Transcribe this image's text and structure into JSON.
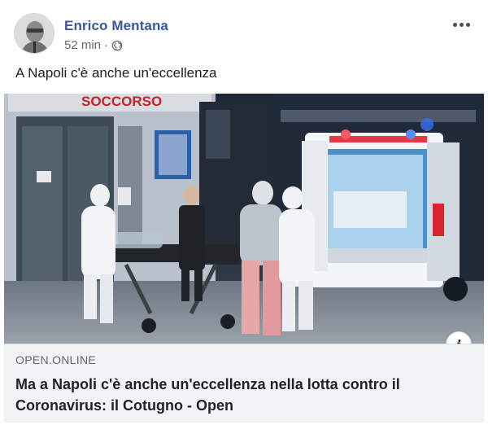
{
  "post": {
    "author": "Enrico Mentana",
    "time": "52 min",
    "separator": "·",
    "privacy_icon": "globe-icon",
    "more_icon": "more-options-icon",
    "message": "A Napoli c'è anche un'eccellenza",
    "image_signage": "SOCCORSO"
  },
  "link_preview": {
    "domain": "OPEN.ONLINE",
    "title": "Ma a Napoli c'è anche un'eccellenza nella lotta contro il Coronavirus: il Cotugno - Open",
    "info_icon": "info-icon",
    "info_label": "i"
  },
  "colors": {
    "author_link": "#385898",
    "meta_text": "#65676b",
    "link_box_bg": "#f2f3f5"
  }
}
